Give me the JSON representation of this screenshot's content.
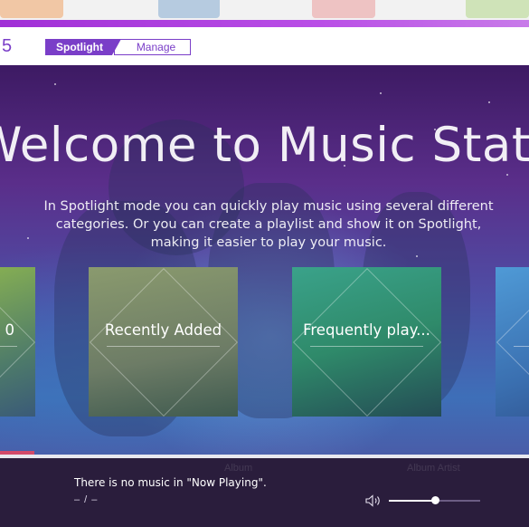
{
  "header": {
    "number": "5",
    "tabs": {
      "spotlight": "Spotlight",
      "manage": "Manage"
    }
  },
  "hero": {
    "title": "Welcome to Music Station",
    "description_lines": [
      "In Spotlight mode you can quickly play music using several different",
      "categories. Or you can create a playlist and show it on Spotlight,",
      "making it easier to play your music."
    ]
  },
  "cards": [
    {
      "label": "0"
    },
    {
      "label": "Recently Added"
    },
    {
      "label": "Frequently play..."
    },
    {
      "label": ""
    }
  ],
  "player": {
    "column_album": "Album",
    "column_album_artist": "Album Artist",
    "status": "There is no music in \"Now Playing\".",
    "time": "– / –",
    "volume_fraction": 0.5,
    "volume_icon": "speaker-icon"
  },
  "colors": {
    "accent": "#7a3ec8",
    "top_bar": "#b94ee6",
    "player_bg": "#2a1d3c"
  }
}
